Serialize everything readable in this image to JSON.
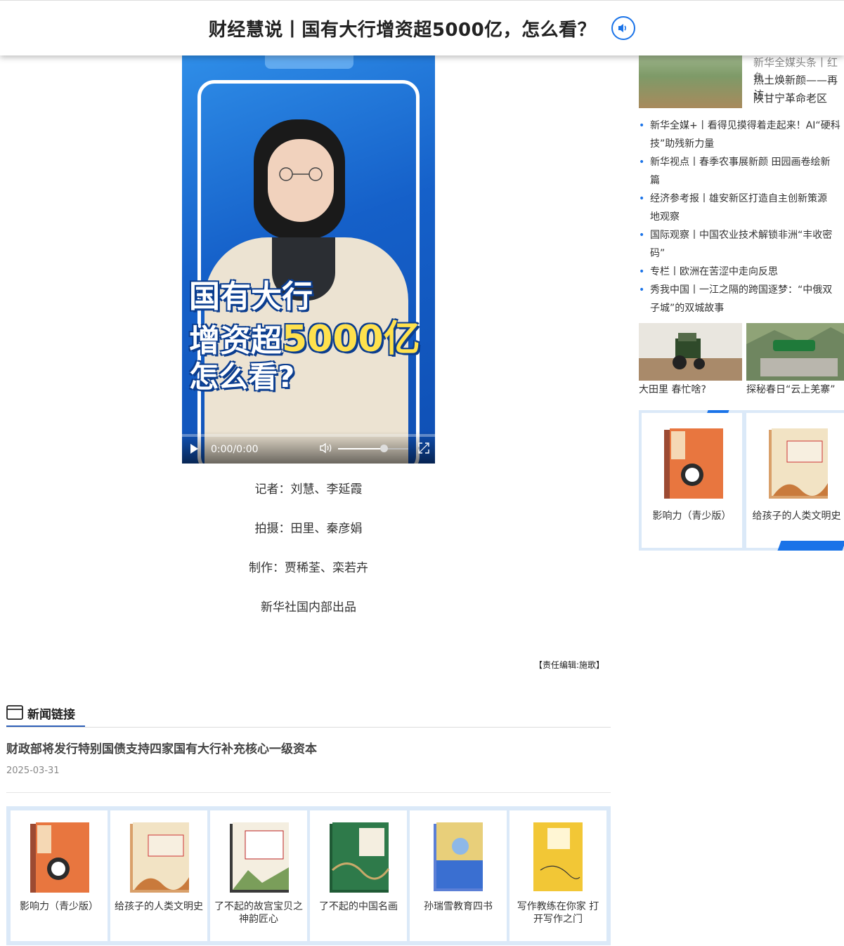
{
  "header": {
    "title": "财经慧说丨国有大行增资超5000亿，怎么看？"
  },
  "video": {
    "caption_line1": "国有大行",
    "caption_line2_a": "增资超",
    "caption_line2_b": "5000亿",
    "caption_line3": "怎么看?",
    "time": "0:00/0:00",
    "volume_level": 0.65,
    "progress": 0
  },
  "credits": {
    "reporter": "记者：刘慧、李延霞",
    "camera": "拍摄：田里、秦彦娟",
    "producer": "制作：贾稀荃、栾若卉",
    "publisher": "新华社国内部出品",
    "editor": "【责任编辑:施歌】"
  },
  "news_links": {
    "heading": "新闻链接",
    "items": [
      {
        "title": "财政部将发行特别国债支持四家国有大行补充核心一级资本",
        "date": "2025-03-31"
      }
    ]
  },
  "books_bottom": [
    {
      "title": "影响力（青少版）",
      "color": "#e8763f"
    },
    {
      "title": "给孩子的人类文明史",
      "color": "#f2e3c4"
    },
    {
      "title": "了不起的故宫宝贝之神韵匠心",
      "color": "#f4eee0"
    },
    {
      "title": "了不起的中国名画",
      "color": "#2e7a4a"
    },
    {
      "title": "孙瑞雪教育四书",
      "color": "#3a6fd1"
    },
    {
      "title": "写作教练在你家 打开写作之门",
      "color": "#f2c736"
    }
  ],
  "right_column": {
    "top_feature": {
      "line1": "新华全媒头条丨红色",
      "line2": "热土焕新颜——再访",
      "line3": "陕甘宁革命老区"
    },
    "list": [
      {
        "l1": "新华全媒+丨看得见摸得着走起来！AI“硬科",
        "l2": "技”助残新力量"
      },
      {
        "l1": "新华视点丨春季农事展新颜 田园画卷绘新",
        "l2": "篇"
      },
      {
        "l1": "经济参考报丨雄安新区打造自主创新策源",
        "l2": "地观察"
      },
      {
        "l1": "国际观察丨中国农业技术解锁非洲“丰收密",
        "l2": "码”"
      },
      {
        "l1": "专栏丨欧洲在苦涩中走向反思",
        "l2": ""
      },
      {
        "l1": "秀我中国丨一江之隔的跨国逐梦：“中俄双",
        "l2": "子城”的双城故事"
      }
    ],
    "pics": [
      {
        "caption": "大田里 春忙啥?"
      },
      {
        "caption": "探秘春日“云上羌寨”",
        "badge": "探秘春日“云上羌寨”"
      }
    ],
    "books": [
      {
        "title": "影响力（青少版）"
      },
      {
        "title": "给孩子的人类文明史"
      }
    ]
  }
}
